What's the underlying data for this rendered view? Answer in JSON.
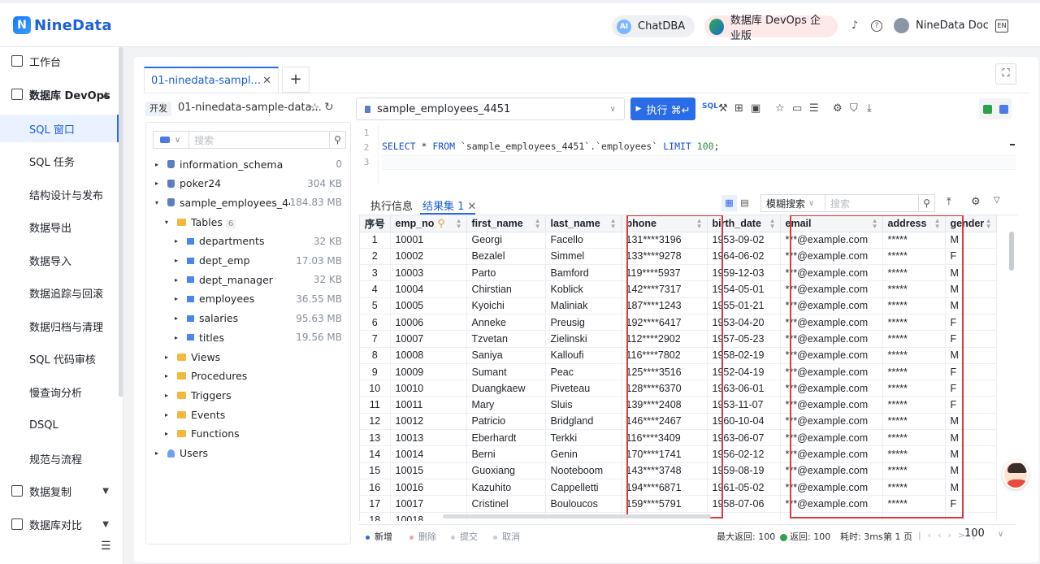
{
  "brand": {
    "logo_text": "NineData"
  },
  "topbar": {
    "chatdba": "ChatDBA",
    "devops_edition": "数据库 DevOps 企业版",
    "doc_link": "NineData Doc"
  },
  "sidebar": {
    "workbench": "工作台",
    "devops": "数据库 DevOps",
    "items": [
      "SQL 窗口",
      "SQL 任务",
      "结构设计与发布",
      "数据导出",
      "数据导入",
      "数据追踪与回滚",
      "数据归档与清理",
      "SQL 代码审核",
      "慢查询分析",
      "DSQL",
      "规范与流程"
    ],
    "replication": "数据复制",
    "compare": "数据库对比"
  },
  "tabs": {
    "query_tab": "01-ninedata-sampl...",
    "add": "+"
  },
  "connection": {
    "env_badge": "开发",
    "name": "01-ninedata-sample-data..."
  },
  "tree": {
    "search_placeholder": "搜索",
    "nodes": [
      {
        "name": "information_schema",
        "size": "0"
      },
      {
        "name": "poker24",
        "size": "304 KB"
      },
      {
        "name": "sample_employees_44...",
        "size": "184.83 MB"
      },
      {
        "name": "Tables",
        "count": "6"
      },
      {
        "name": "departments",
        "size": "32 KB"
      },
      {
        "name": "dept_emp",
        "size": "17.03 MB"
      },
      {
        "name": "dept_manager",
        "size": "32 KB"
      },
      {
        "name": "employees",
        "size": "36.55 MB"
      },
      {
        "name": "salaries",
        "size": "95.63 MB"
      },
      {
        "name": "titles",
        "size": "19.56 MB"
      },
      {
        "name": "Views"
      },
      {
        "name": "Procedures"
      },
      {
        "name": "Triggers"
      },
      {
        "name": "Events"
      },
      {
        "name": "Functions"
      },
      {
        "name": "Users"
      }
    ]
  },
  "editor": {
    "database": "sample_employees_4451",
    "run_label": "执行 ⌘↵",
    "line_numbers": [
      "1",
      "2",
      "3"
    ],
    "sql_keyword_select": "SELECT",
    "sql_mid": " * ",
    "sql_keyword_from": "FROM",
    "sql_table": " `sample_employees_4451`.`employees` ",
    "sql_keyword_limit": "LIMIT",
    "sql_limit": " 100",
    "sql_end": ";"
  },
  "results": {
    "exec_info": "执行信息",
    "result_tab": "结果集 1",
    "fuzzy_search": "模糊搜索",
    "search_placeholder": "搜索",
    "columns": [
      "序号",
      "emp_no",
      "first_name",
      "last_name",
      "phone",
      "birth_date",
      "email",
      "address",
      "gender"
    ],
    "rows": [
      [
        "1",
        "10001",
        "Georgi",
        "Facello",
        "131****3196",
        "1953-09-02",
        "***@example.com",
        "*****",
        "M"
      ],
      [
        "2",
        "10002",
        "Bezalel",
        "Simmel",
        "133****9278",
        "1964-06-02",
        "***@example.com",
        "*****",
        "F"
      ],
      [
        "3",
        "10003",
        "Parto",
        "Bamford",
        "119****5937",
        "1959-12-03",
        "***@example.com",
        "*****",
        "M"
      ],
      [
        "4",
        "10004",
        "Chirstian",
        "Koblick",
        "142****7317",
        "1954-05-01",
        "***@example.com",
        "*****",
        "M"
      ],
      [
        "5",
        "10005",
        "Kyoichi",
        "Maliniak",
        "187****1243",
        "1955-01-21",
        "***@example.com",
        "*****",
        "M"
      ],
      [
        "6",
        "10006",
        "Anneke",
        "Preusig",
        "192****6417",
        "1953-04-20",
        "***@example.com",
        "*****",
        "F"
      ],
      [
        "7",
        "10007",
        "Tzvetan",
        "Zielinski",
        "112****2902",
        "1957-05-23",
        "***@example.com",
        "*****",
        "F"
      ],
      [
        "8",
        "10008",
        "Saniya",
        "Kalloufi",
        "116****7802",
        "1958-02-19",
        "***@example.com",
        "*****",
        "M"
      ],
      [
        "9",
        "10009",
        "Sumant",
        "Peac",
        "125****3516",
        "1952-04-19",
        "***@example.com",
        "*****",
        "F"
      ],
      [
        "10",
        "10010",
        "Duangkaew",
        "Piveteau",
        "128****6370",
        "1963-06-01",
        "***@example.com",
        "*****",
        "F"
      ],
      [
        "11",
        "10011",
        "Mary",
        "Sluis",
        "139****2408",
        "1953-11-07",
        "***@example.com",
        "*****",
        "F"
      ],
      [
        "12",
        "10012",
        "Patricio",
        "Bridgland",
        "146****2467",
        "1960-10-04",
        "***@example.com",
        "*****",
        "M"
      ],
      [
        "13",
        "10013",
        "Eberhardt",
        "Terkki",
        "116****3409",
        "1963-06-07",
        "***@example.com",
        "*****",
        "M"
      ],
      [
        "14",
        "10014",
        "Berni",
        "Genin",
        "170****1741",
        "1956-02-12",
        "***@example.com",
        "*****",
        "M"
      ],
      [
        "15",
        "10015",
        "Guoxiang",
        "Nooteboom",
        "143****3748",
        "1959-08-19",
        "***@example.com",
        "*****",
        "M"
      ],
      [
        "16",
        "10016",
        "Kazuhito",
        "Cappelletti",
        "194****6871",
        "1961-05-02",
        "***@example.com",
        "*****",
        "M"
      ],
      [
        "17",
        "10017",
        "Cristinel",
        "Bouloucos",
        "159****5791",
        "1958-07-06",
        "***@example.com",
        "*****",
        "F"
      ],
      [
        "18",
        "10018",
        "",
        "",
        "",
        "",
        "",
        "",
        ""
      ]
    ]
  },
  "footer": {
    "add": "新增",
    "delete": "删除",
    "submit": "提交",
    "cancel": "取消",
    "max_return": "最大返回: 100",
    "returned": "返回: 100",
    "elapsed": "耗时: 3ms",
    "page": "第 1 页",
    "page_size": "100"
  },
  "colors": {
    "accent": "#2a6be8",
    "highlight": "#d93b3b",
    "brand": "#1d62d8"
  }
}
